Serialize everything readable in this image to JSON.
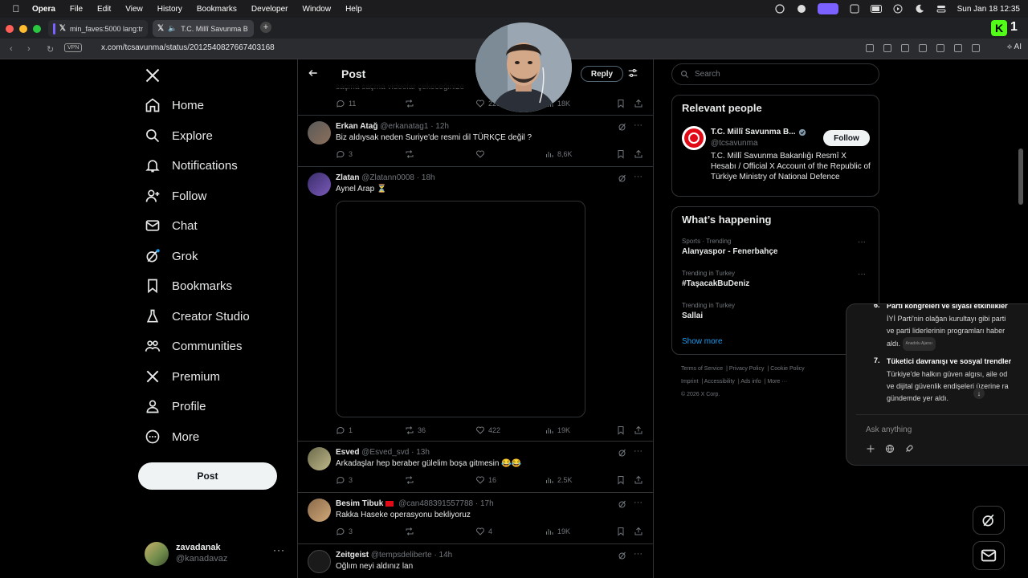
{
  "menubar": {
    "app": "Opera",
    "items": [
      "File",
      "Edit",
      "View",
      "History",
      "Bookmarks",
      "Developer",
      "Window",
      "Help"
    ],
    "datetime": "Sun Jan 18  12:35"
  },
  "browser": {
    "tabs": [
      {
        "label": "min_faves:5000 lang:tr"
      },
      {
        "label": "T.C. Millî Savunma B"
      }
    ],
    "url": "x.com/tcsavunma/status/2012540827667403168",
    "vpn_label": "VPN",
    "ai_label": "AI"
  },
  "nav": {
    "items": [
      {
        "label": "Home",
        "icon": "home-icon"
      },
      {
        "label": "Explore",
        "icon": "search-icon"
      },
      {
        "label": "Notifications",
        "icon": "bell-icon"
      },
      {
        "label": "Follow",
        "icon": "add-person-icon"
      },
      {
        "label": "Chat",
        "icon": "envelope-icon"
      },
      {
        "label": "Grok",
        "icon": "grok-icon"
      },
      {
        "label": "Bookmarks",
        "icon": "bookmark-icon"
      },
      {
        "label": "Creator Studio",
        "icon": "flask-icon"
      },
      {
        "label": "Communities",
        "icon": "people-icon"
      },
      {
        "label": "Premium",
        "icon": "x-icon"
      },
      {
        "label": "Profile",
        "icon": "person-icon"
      },
      {
        "label": "More",
        "icon": "more-circle-icon"
      }
    ],
    "post_label": "Post",
    "account": {
      "name": "zavadanak",
      "handle": "@kanadavaz"
    }
  },
  "main": {
    "title": "Post",
    "reply_label": "Reply",
    "ghost_text": "saçma saçma videolar çekeceğinize",
    "top_actions": {
      "replies": "11",
      "likes": "226",
      "views": "18K"
    },
    "tweets": [
      {
        "name": "Erkan Atağ",
        "handle": "@erkanatag1",
        "time": "· 12h",
        "text": "Biz aldıysak neden Suriye'de resmi dil TÜRKÇE değil ?",
        "replies": "3",
        "retweets": "",
        "likes": "",
        "views": "8,6K"
      },
      {
        "name": "Zlatan",
        "handle": "@Zlatann0008",
        "time": "· 18h",
        "text": "Aynel Arap ⏳",
        "replies": "1",
        "retweets": "36",
        "likes": "422",
        "views": "19K"
      },
      {
        "name": "Esved",
        "handle": "@Esved_svd",
        "time": "· 13h",
        "text": "Arkadaşlar hep beraber gülelim boşa gitmesin 😂😂",
        "replies": "3",
        "retweets": "",
        "likes": "16",
        "views": "2.5K"
      },
      {
        "name": "Besim Tibuk",
        "handle": "@can488391557788",
        "time": "· 17h",
        "text": "Rakka Haseke operasyonu bekliyoruz",
        "replies": "3",
        "retweets": "",
        "likes": "4",
        "views": "19K"
      },
      {
        "name": "Zeitgeist",
        "handle": "@tempsdeliberte",
        "time": "· 14h",
        "text": "Oğlım neyi aldınız lan"
      }
    ]
  },
  "right": {
    "search_placeholder": "Search",
    "relevant": {
      "title": "Relevant people",
      "name": "T.C. Millî Savunma B...",
      "handle": "@tcsavunma",
      "follow_label": "Follow",
      "bio": "T.C. Millî Savunma Bakanlığı Resmî X Hesabı / Official X Account of the Republic of Türkiye Ministry of National Defence"
    },
    "happening": {
      "title": "What’s happening",
      "trends": [
        {
          "meta": "Sports · Trending",
          "title": "Alanyaspor - Fenerbahçe"
        },
        {
          "meta": "Trending in Turkey",
          "title": "#TaşacakBuDeniz"
        },
        {
          "meta": "Trending in Turkey",
          "title": "Sallai"
        }
      ],
      "show_more": "Show more"
    },
    "footer": {
      "links": [
        "Terms of Service",
        "Privacy Policy",
        "Cookie Policy",
        "Imprint",
        "Accessibility",
        "Ads info",
        "More ···"
      ],
      "copyright": "© 2026 X Corp."
    }
  },
  "grok": {
    "items": [
      {
        "number": "6.",
        "title": "Parti kongreleri ve siyasi etkinlikler",
        "lines": [
          "İYİ Parti'nin olağan kurultayı gibi parti",
          "ve parti liderlerinin programları haber",
          "aldı."
        ],
        "source": "Anadolu Ajansı"
      },
      {
        "number": "7.",
        "title": "Tüketici davranışı ve sosyal trendler",
        "lines": [
          "Türkiye'de halkın güven algısı, aile od",
          "ve dijital güvenlik endişeleri üzerine ra",
          "gündemde yer aldı."
        ],
        "source": ""
      }
    ],
    "input_placeholder": "Ask anything"
  },
  "colors": {
    "accent": "#1d9bf0",
    "border": "#2f3336",
    "muted": "#71767b",
    "grok_pill": "#7b61ff",
    "badge_green": "#00c853"
  }
}
